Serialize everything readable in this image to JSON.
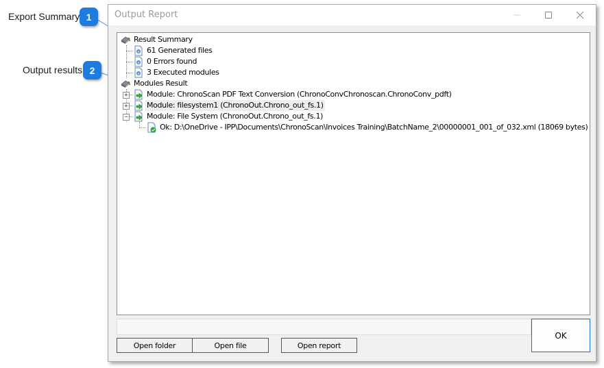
{
  "callouts": [
    {
      "number": "1",
      "label": "Export Summary"
    },
    {
      "number": "2",
      "label": "Output results"
    }
  ],
  "window": {
    "title": "Output Report",
    "controls": {
      "minimize": "minimize-icon",
      "maximize": "maximize-icon",
      "close": "close-icon"
    }
  },
  "tree": {
    "result_summary": {
      "label": "Result Summary",
      "icon": "book-icon",
      "children": [
        {
          "label": "61 Generated files",
          "icon": "info-document-icon"
        },
        {
          "label": "0 Errors found",
          "icon": "info-document-icon"
        },
        {
          "label": "3 Executed modules",
          "icon": "info-document-icon"
        }
      ]
    },
    "modules_result": {
      "label": "Modules Result",
      "icon": "book-icon",
      "children": [
        {
          "label": "Module: ChronoScan PDF Text Conversion (ChronoConvChronoscan.ChronoConv_pdft)",
          "icon": "export-document-icon",
          "expanded": false,
          "selected": false
        },
        {
          "label": "Module: filesystem1 (ChronoOut.Chrono_out_fs.1)",
          "icon": "export-document-icon",
          "expanded": false,
          "selected": true
        },
        {
          "label": "Module: File System (ChronoOut.Chrono_out_fs.1)",
          "icon": "export-document-icon",
          "expanded": true,
          "selected": false,
          "children": [
            {
              "label": "Ok: D:\\OneDrive - IPP\\Documents\\ChronoScan\\Invoices Training\\BatchName_2\\00000001_001_of_032.xml (18069 bytes)",
              "icon": "ok-document-icon"
            }
          ]
        }
      ]
    }
  },
  "status_field": {
    "value": ""
  },
  "buttons": {
    "open_folder": "Open folder",
    "open_file": "Open file",
    "open_report": "Open report",
    "ok": "OK"
  },
  "colors": {
    "callout_badge": "#1e7be0",
    "ok_border": "#1a6cc4",
    "leader_line": "#3d8fe0"
  }
}
